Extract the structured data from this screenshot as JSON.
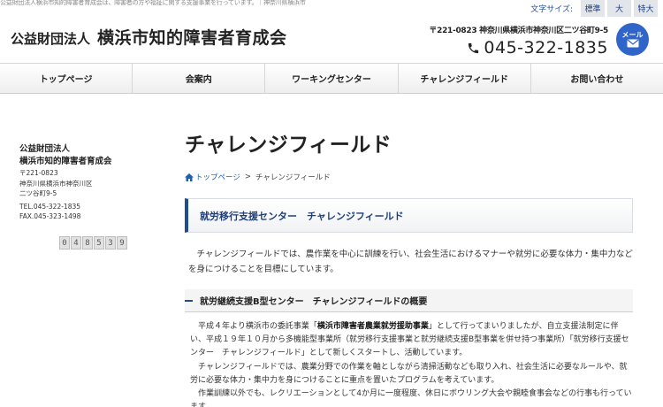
{
  "top_strip": "公益財団法人横浜市知的障害者育成会は、障害者の方や福祉に関する支援事業を行っています。｜神奈川県横浜市",
  "font_size": {
    "label": "文字サイズ:",
    "options": [
      "標準",
      "大",
      "特大"
    ]
  },
  "header": {
    "org_type": "公益財団法人",
    "org_name": "横浜市知的障害者育成会",
    "address": "〒221-0823 神奈川県横浜市神奈川区二ツ谷町9-5",
    "phone": "045-322-1835",
    "mail_label": "メール"
  },
  "nav": [
    {
      "label": "トップページ"
    },
    {
      "label": "会案内"
    },
    {
      "label": "ワーキングセンター"
    },
    {
      "label": "チャレンジフィールド"
    },
    {
      "label": "お問い合わせ"
    }
  ],
  "sidebar": {
    "org1": "公益財団法人",
    "org2": "横浜市知的障害者育成会",
    "postal": "〒221-0823",
    "address1": "神奈川県横浜市神奈川区",
    "address2": "二ツ谷町9-5",
    "tel": "TEL.045-322-1835",
    "fax": "FAX.045-323-1498",
    "counter": [
      "0",
      "4",
      "8",
      "5",
      "3",
      "9"
    ]
  },
  "main": {
    "title": "チャレンジフィールド",
    "breadcrumb": {
      "home": "トップページ",
      "separator": ">",
      "current": "チャレンジフィールド"
    },
    "section_title": "就労移行支援センター　チャレンジフィールド",
    "intro": "チャレンジフィールドでは、農作業を中心に訓練を行い、社会生活におけるマナーや就労に必要な体力・集中力などを身につけることを目標にしています。",
    "subhead": "就労継続支援B型センター　チャレンジフィールドの概要",
    "para1_pre": "平成４年より横浜市の委託事業「",
    "para1_bold": "横浜市障害者農業就労援助事業",
    "para1_post": "」として行ってまいりましたが、自立支援法制定に伴い、平成１９年１０月から多機能型事業所（就労移行支援事業と就労継続支援B型事業を併せ持つ事業所）「就労移行支援センター　チャレンジフィールド」として新しくスタートし、活動しています。",
    "para2": "チャレンジフィールドでは、農業分野での作業を軸としながら清掃活動なども取り入れ、社会生活に必要なルールや、就労に必要な体力・集中力を身につけることに重点を置いたプログラムを考えています。",
    "para3": "作業訓練以外でも、レクリエーションとして4か月に一度程度、休日にボウリング大会や親睦食事会などの行事も行っています。"
  }
}
